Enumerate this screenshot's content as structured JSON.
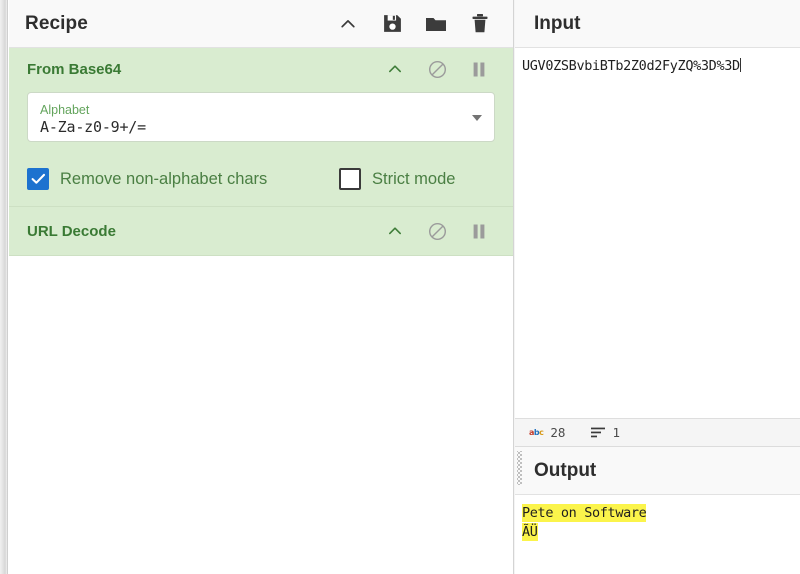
{
  "recipe": {
    "title": "Recipe",
    "icons": [
      {
        "name": "collapse-chevron-up-icon",
        "glyph": "chevron-up"
      },
      {
        "name": "save-recipe-icon",
        "glyph": "floppy-disk"
      },
      {
        "name": "load-recipe-icon",
        "glyph": "folder"
      },
      {
        "name": "clear-recipe-icon",
        "glyph": "trash"
      }
    ],
    "operations": [
      {
        "title": "From Base64",
        "icons": [
          {
            "name": "operation-collapse-icon",
            "glyph": "chevron-up"
          },
          {
            "name": "disable-operation-icon",
            "glyph": "circle-slash"
          },
          {
            "name": "set-breakpoint-icon",
            "glyph": "pause"
          }
        ],
        "arg_label": "Alphabet",
        "arg_value": "A-Za-z0-9+/=",
        "checkboxes": [
          {
            "label": "Remove non-alphabet chars",
            "checked": true
          },
          {
            "label": "Strict mode",
            "checked": false
          }
        ]
      },
      {
        "title": "URL Decode",
        "icons": [
          {
            "name": "operation-collapse-icon",
            "glyph": "chevron-up"
          },
          {
            "name": "disable-operation-icon",
            "glyph": "circle-slash"
          },
          {
            "name": "set-breakpoint-icon",
            "glyph": "pause"
          }
        ]
      }
    ]
  },
  "input": {
    "title": "Input",
    "value": "UGV0ZSBvbiBTb2Z0d2FyZQ%3D%3D",
    "status": {
      "length_icon": "abc-icon",
      "length": "28",
      "lines_icon": "lines-icon",
      "lines": "1"
    }
  },
  "output": {
    "title": "Output",
    "lines": [
      "Pete on Software",
      "ÃÜ"
    ]
  },
  "colors": {
    "operation_bg": "#d9ecd0",
    "operation_title": "#3a7a34",
    "checkbox_checked": "#1d72cf",
    "highlight": "#fbf44b",
    "pane_header_bg": "#f9f9f9"
  }
}
